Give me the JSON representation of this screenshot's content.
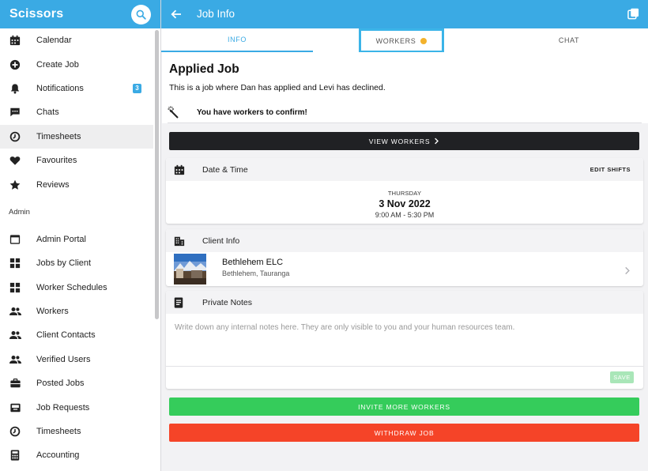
{
  "sidebar": {
    "app_title": "Scissors",
    "items": [
      {
        "label": "Calendar",
        "icon": "calendar-icon"
      },
      {
        "label": "Create Job",
        "icon": "plus-circle-icon"
      },
      {
        "label": "Notifications",
        "icon": "bell-icon",
        "badge": "3"
      },
      {
        "label": "Chats",
        "icon": "chat-icon"
      },
      {
        "label": "Timesheets",
        "icon": "timesheet-icon",
        "active": true
      },
      {
        "label": "Favourites",
        "icon": "heart-icon"
      },
      {
        "label": "Reviews",
        "icon": "star-icon"
      }
    ],
    "section_label": "Admin",
    "admin_items": [
      {
        "label": "Admin Portal",
        "icon": "portal-icon"
      },
      {
        "label": "Jobs by Client",
        "icon": "grid-icon"
      },
      {
        "label": "Worker Schedules",
        "icon": "grid-icon"
      },
      {
        "label": "Workers",
        "icon": "people-icon"
      },
      {
        "label": "Client Contacts",
        "icon": "people-icon"
      },
      {
        "label": "Verified Users",
        "icon": "people-icon"
      },
      {
        "label": "Posted Jobs",
        "icon": "briefcase-icon"
      },
      {
        "label": "Job Requests",
        "icon": "inbox-icon"
      },
      {
        "label": "Timesheets",
        "icon": "timesheet-icon"
      },
      {
        "label": "Accounting",
        "icon": "calculator-icon"
      }
    ]
  },
  "header": {
    "title": "Job Info"
  },
  "tabs": {
    "info": "INFO",
    "workers": "WORKERS",
    "chat": "CHAT"
  },
  "job": {
    "title": "Applied Job",
    "description": "This is a job where Dan has applied and Levi has declined.",
    "confirm_text": "You have workers to confirm!",
    "view_workers": "VIEW WORKERS"
  },
  "datetime": {
    "heading": "Date & Time",
    "action": "EDIT SHIFTS",
    "day": "THURSDAY",
    "date": "3 Nov 2022",
    "time": "9:00 AM - 5:30 PM"
  },
  "client": {
    "heading": "Client Info",
    "name": "Bethlehem ELC",
    "location": "Bethlehem, Tauranga"
  },
  "notes": {
    "heading": "Private Notes",
    "placeholder": "Write down any internal notes here. They are only visible to you and your human resources team.",
    "save": "SAVE"
  },
  "actions": {
    "invite": "INVITE MORE WORKERS",
    "withdraw": "WITHDRAW JOB"
  },
  "colors": {
    "brand": "#3aaae4",
    "dark_button": "#202124",
    "invite_button": "#35cc5b",
    "withdraw_button": "#f54428",
    "workers_dot": "#f3b22c"
  }
}
